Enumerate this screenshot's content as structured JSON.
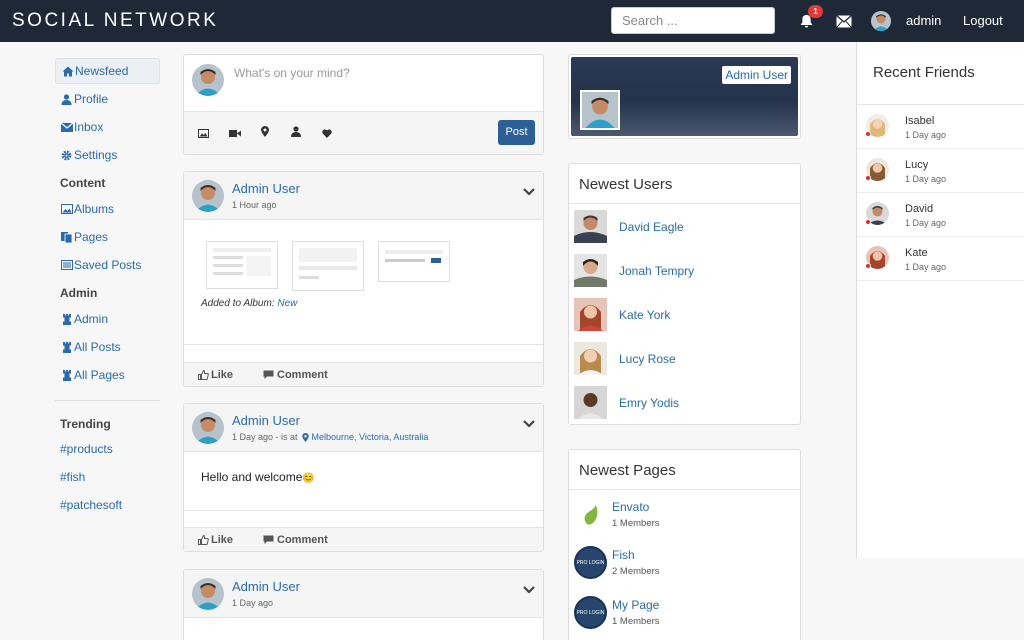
{
  "app": {
    "brand": "SOCIAL NETWORK"
  },
  "topbar": {
    "search_placeholder": "Search ...",
    "notification_count": "1",
    "icons": [
      "bell-icon",
      "envelope-icon"
    ],
    "username": "admin",
    "logout": "Logout"
  },
  "nav": {
    "main": [
      {
        "label": "Newsfeed",
        "icon": "home-icon",
        "active": true
      },
      {
        "label": "Profile",
        "icon": "user-icon"
      },
      {
        "label": "Inbox",
        "icon": "envelope-icon"
      },
      {
        "label": "Settings",
        "icon": "gear-icon"
      }
    ],
    "content_heading": "Content",
    "content": [
      {
        "label": "Albums",
        "icon": "image-icon"
      },
      {
        "label": "Pages",
        "icon": "pages-icon"
      },
      {
        "label": "Saved Posts",
        "icon": "list-icon"
      }
    ],
    "admin_heading": "Admin",
    "admin": [
      {
        "label": "Admin",
        "icon": "chess-icon"
      },
      {
        "label": "All Posts",
        "icon": "chess-icon"
      },
      {
        "label": "All Pages",
        "icon": "chess-icon"
      }
    ],
    "trending_heading": "Trending",
    "trending": [
      "#products",
      "#fish",
      "#patchesoft"
    ]
  },
  "composer": {
    "placeholder": "What's on your mind?",
    "post_button": "Post",
    "tools": [
      "image-icon",
      "video-icon",
      "location-icon",
      "user-icon",
      "heart-icon"
    ]
  },
  "posts": [
    {
      "author": "Admin User",
      "time": "1 Hour ago",
      "album_prefix": "Added to Album:",
      "album_name": "New",
      "like": "Like",
      "comment": "Comment"
    },
    {
      "author": "Admin User",
      "time": "1 Day ago - is at",
      "location": "Melbourne, Victoria, Australia",
      "body": "Hello and welcome",
      "emoji": "😊",
      "like": "Like",
      "comment": "Comment"
    },
    {
      "author": "Admin User",
      "time": "1 Day ago"
    }
  ],
  "profile_card": {
    "name": "Admin User"
  },
  "newest_users": {
    "title": "Newest Users",
    "users": [
      "David Eagle",
      "Jonah Tempry",
      "Kate York",
      "Lucy Rose",
      "Emry Yodis"
    ]
  },
  "newest_pages": {
    "title": "Newest Pages",
    "pages": [
      {
        "name": "Envato",
        "members": "1 Members",
        "logo": "envato-leaf-icon"
      },
      {
        "name": "Fish",
        "members": "2 Members",
        "logo": "pro-login-logo",
        "logo_text": "PRO LOGIN"
      },
      {
        "name": "My Page",
        "members": "1 Members",
        "logo": "pro-login-logo",
        "logo_text": "PRO LOGIN"
      }
    ]
  },
  "recent_friends": {
    "title": "Recent Friends",
    "friends": [
      {
        "name": "Isabel",
        "time": "1 Day ago"
      },
      {
        "name": "Lucy",
        "time": "1 Day ago"
      },
      {
        "name": "David",
        "time": "1 Day ago"
      },
      {
        "name": "Kate",
        "time": "1 Day ago"
      }
    ]
  },
  "colors": {
    "topbar": "#1f2837",
    "link": "#2a6aad",
    "post_button": "#2c5f96",
    "badge": "#e23a3a",
    "online_dot": "#d9302c"
  }
}
